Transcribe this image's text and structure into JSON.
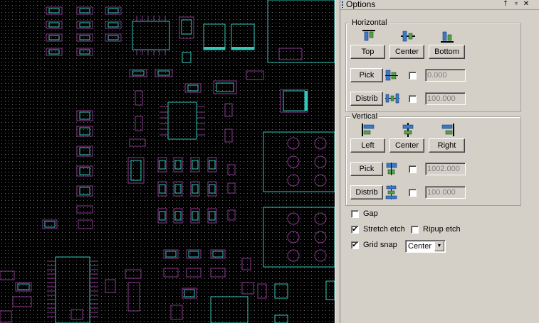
{
  "panel": {
    "title": "Options",
    "pin_glyph": "†",
    "menu_glyph": "▾",
    "close_glyph": "✕"
  },
  "horizontal": {
    "label": "Horizontal",
    "top_label": "Top",
    "center_label": "Center",
    "bottom_label": "Bottom",
    "pick_label": "Pick",
    "pick_value": "0.000",
    "distrib_label": "Distrib",
    "distrib_value": "100.000"
  },
  "vertical": {
    "label": "Vertical",
    "left_label": "Left",
    "center_label": "Center",
    "right_label": "Right",
    "pick_label": "Pick",
    "pick_value": "1002.000",
    "distrib_label": "Distrib",
    "distrib_value": "100.000"
  },
  "options": {
    "gap_label": "Gap",
    "gap_checked": false,
    "stretch_label": "Stretch etch",
    "stretch_checked": true,
    "ripup_label": "Ripup etch",
    "ripup_checked": false,
    "gridsnap_label": "Grid snap",
    "gridsnap_checked": true,
    "snap_mode": "Center"
  },
  "colors": {
    "canvas_bg": "#000000",
    "pad_outline": "#30c8b8",
    "silkscreen": "#8a3a90",
    "panel_bg": "#d4d0c8"
  }
}
